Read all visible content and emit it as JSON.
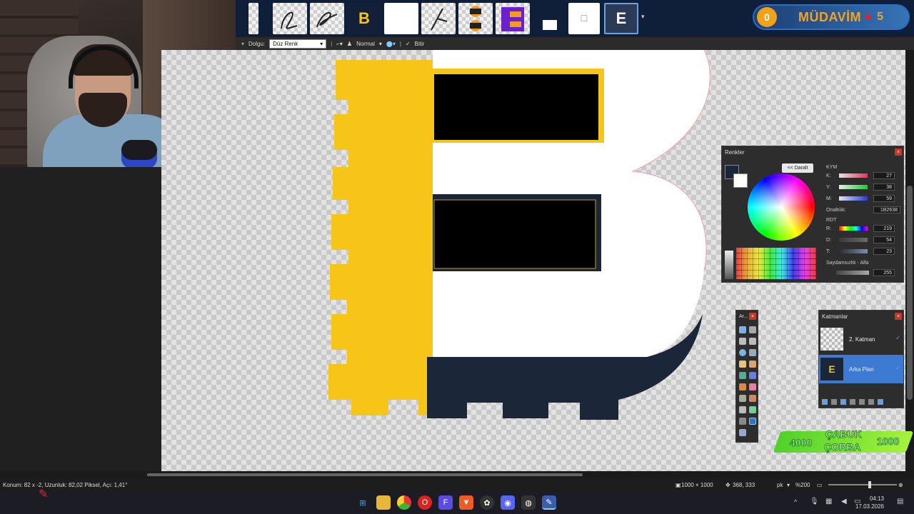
{
  "toolbar": {
    "fill_label": "Dolgu:",
    "fill_value": "Düz Renk",
    "blend_mode": "Normal",
    "finish_label": "Bitir",
    "thumb_b_glyph": "B",
    "thumb_e_glyph": "E"
  },
  "badge": {
    "left_value": "0",
    "label": "MÜDAVİM",
    "right_value": "5"
  },
  "colors_panel": {
    "title": "Renkler",
    "collapse_button": "<< Daralt",
    "kym_label": "KYM",
    "k_label": "K:",
    "y_label": "Y:",
    "m_label": "M:",
    "k_value": "27",
    "y_value": "38",
    "m_value": "59",
    "hex_label": "Onaltılık:",
    "hex_value": "1B2638",
    "rdt_label": "RDT",
    "r_label": "R:",
    "d_label": "D:",
    "t_label": "T:",
    "r_value": "219",
    "d_value": "54",
    "t_value": "23",
    "alpha_label": "Saydamsızlık - Alfa",
    "alpha_value": "255"
  },
  "tools_panel": {
    "title": "Ar..."
  },
  "layers_panel": {
    "title": "Katmanlar",
    "layers": [
      {
        "name": "2. Katman"
      },
      {
        "name": "Arka Plan"
      }
    ]
  },
  "sticker": {
    "left_num": "4000",
    "line1": "ÇABUK",
    "line2": "ÇORBA",
    "right_num": "1000"
  },
  "status": {
    "position": "Konum: 82 x -2, Uzunluk: 82,02 Piksel, Açı: 1,41°",
    "image_size": "1000 × 1000",
    "cursor": "368, 333",
    "unit": "pk",
    "zoom": "%200"
  },
  "clock": {
    "time": "04:13",
    "date": "17.03.2026"
  },
  "colors": {
    "yellow": "#f7c518",
    "navy": "#1b2638",
    "accent_blue": "#2a6fc4"
  }
}
